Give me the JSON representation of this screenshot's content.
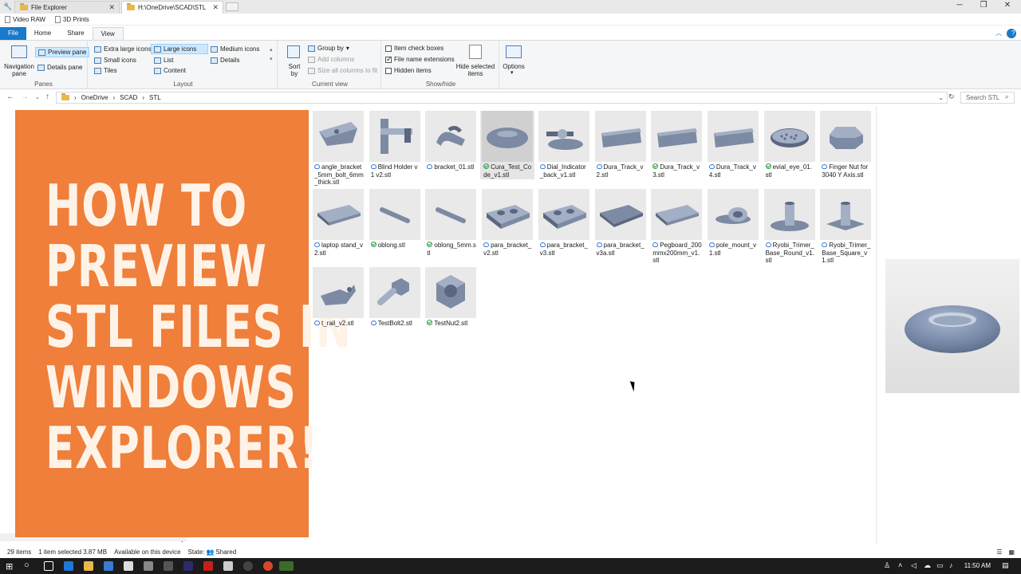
{
  "tabs": [
    {
      "label": "File Explorer",
      "active": false
    },
    {
      "label": "H:\\OneDrive\\SCAD\\STL",
      "active": true
    }
  ],
  "quick_access": [
    "Video RAW",
    "3D Prints"
  ],
  "ribbon_tabs": [
    "File",
    "Home",
    "Share",
    "View"
  ],
  "ribbon": {
    "panes": {
      "navigation": "Navigation pane",
      "preview": "Preview pane",
      "details": "Details pane",
      "label": "Panes"
    },
    "layout": {
      "items": [
        "Extra large icons",
        "Large icons",
        "Medium icons",
        "Small icons",
        "List",
        "Details",
        "Tiles",
        "Content"
      ],
      "selected": "Large icons",
      "label": "Layout"
    },
    "current_view": {
      "sort": "Sort by",
      "group": "Group by",
      "add_columns": "Add columns",
      "size_columns": "Size all columns to fit",
      "label": "Current view"
    },
    "show_hide": {
      "item_check_boxes": {
        "label": "Item check boxes",
        "checked": false
      },
      "file_name_extensions": {
        "label": "File name extensions",
        "checked": true
      },
      "hidden_items": {
        "label": "Hidden items",
        "checked": false
      },
      "hide_selected": "Hide selected items",
      "label": "Show/hide"
    },
    "options": "Options"
  },
  "address": {
    "crumbs": [
      "OneDrive",
      "SCAD",
      "STL"
    ],
    "search_placeholder": "Search STL"
  },
  "overlay_lines": [
    "HOW TO",
    "PREVIEW",
    "STL FILES IN",
    "WINDOWS",
    "EXPLORER!"
  ],
  "files": [
    {
      "name": "angle_bracket_5mm_bolt_6mm_thick.stl",
      "status": "cloud",
      "shape": "angle"
    },
    {
      "name": "Blind Holder v1 v2.stl",
      "status": "cloud",
      "shape": "holder"
    },
    {
      "name": "bracket_01.stl",
      "status": "cloud",
      "shape": "clip"
    },
    {
      "name": "Cura_Test_Code_v1.stl",
      "status": "ok",
      "shape": "torus",
      "selected": true
    },
    {
      "name": "Dial_Indicator_back_v1.stl",
      "status": "cloud",
      "shape": "dial"
    },
    {
      "name": "Dura_Track_v2.stl",
      "status": "cloud",
      "shape": "track"
    },
    {
      "name": "Dura_Track_v3.stl",
      "status": "ok",
      "shape": "track"
    },
    {
      "name": "Dura_Track_v4.stl",
      "status": "cloud",
      "shape": "track"
    },
    {
      "name": "evial_eye_01.stl",
      "status": "ok",
      "shape": "eye"
    },
    {
      "name": "Finger Nut for 3040 Y Axis.stl",
      "status": "cloud",
      "shape": "knob"
    },
    {
      "name": "laptop stand_v2.stl",
      "status": "cloud",
      "shape": "plate"
    },
    {
      "name": "oblong.stl",
      "status": "ok",
      "shape": "rod"
    },
    {
      "name": "oblong_5mm.stl",
      "status": "ok",
      "shape": "rod"
    },
    {
      "name": "para_bracket_v2.stl",
      "status": "cloud",
      "shape": "para"
    },
    {
      "name": "para_bracket_v3.stl",
      "status": "cloud",
      "shape": "para"
    },
    {
      "name": "para_bracket_v3a.stl",
      "status": "cloud",
      "shape": "paraflat"
    },
    {
      "name": "Pegboard_200mmx200mm_v1.stl",
      "status": "cloud",
      "shape": "plate"
    },
    {
      "name": "pole_mount_v1.stl",
      "status": "cloud",
      "shape": "mount"
    },
    {
      "name": "Ryobi_Trimer_Base_Round_v1.stl",
      "status": "cloud",
      "shape": "baseround"
    },
    {
      "name": "Ryobi_Trimer_Base_Square_v1.stl",
      "status": "cloud",
      "shape": "basesquare"
    },
    {
      "name": "t_rail_v2.stl",
      "status": "cloud",
      "shape": "trail"
    },
    {
      "name": "TestBolt2.stl",
      "status": "cloud",
      "shape": "bolt"
    },
    {
      "name": "TestNut2.stl",
      "status": "ok",
      "shape": "nut"
    }
  ],
  "status": {
    "count": "29 items",
    "selected": "1 item selected  3.87 MB",
    "availability": "Available on this device",
    "state_label": "State:",
    "state_value": "Shared"
  },
  "clock": "11:50 AM"
}
